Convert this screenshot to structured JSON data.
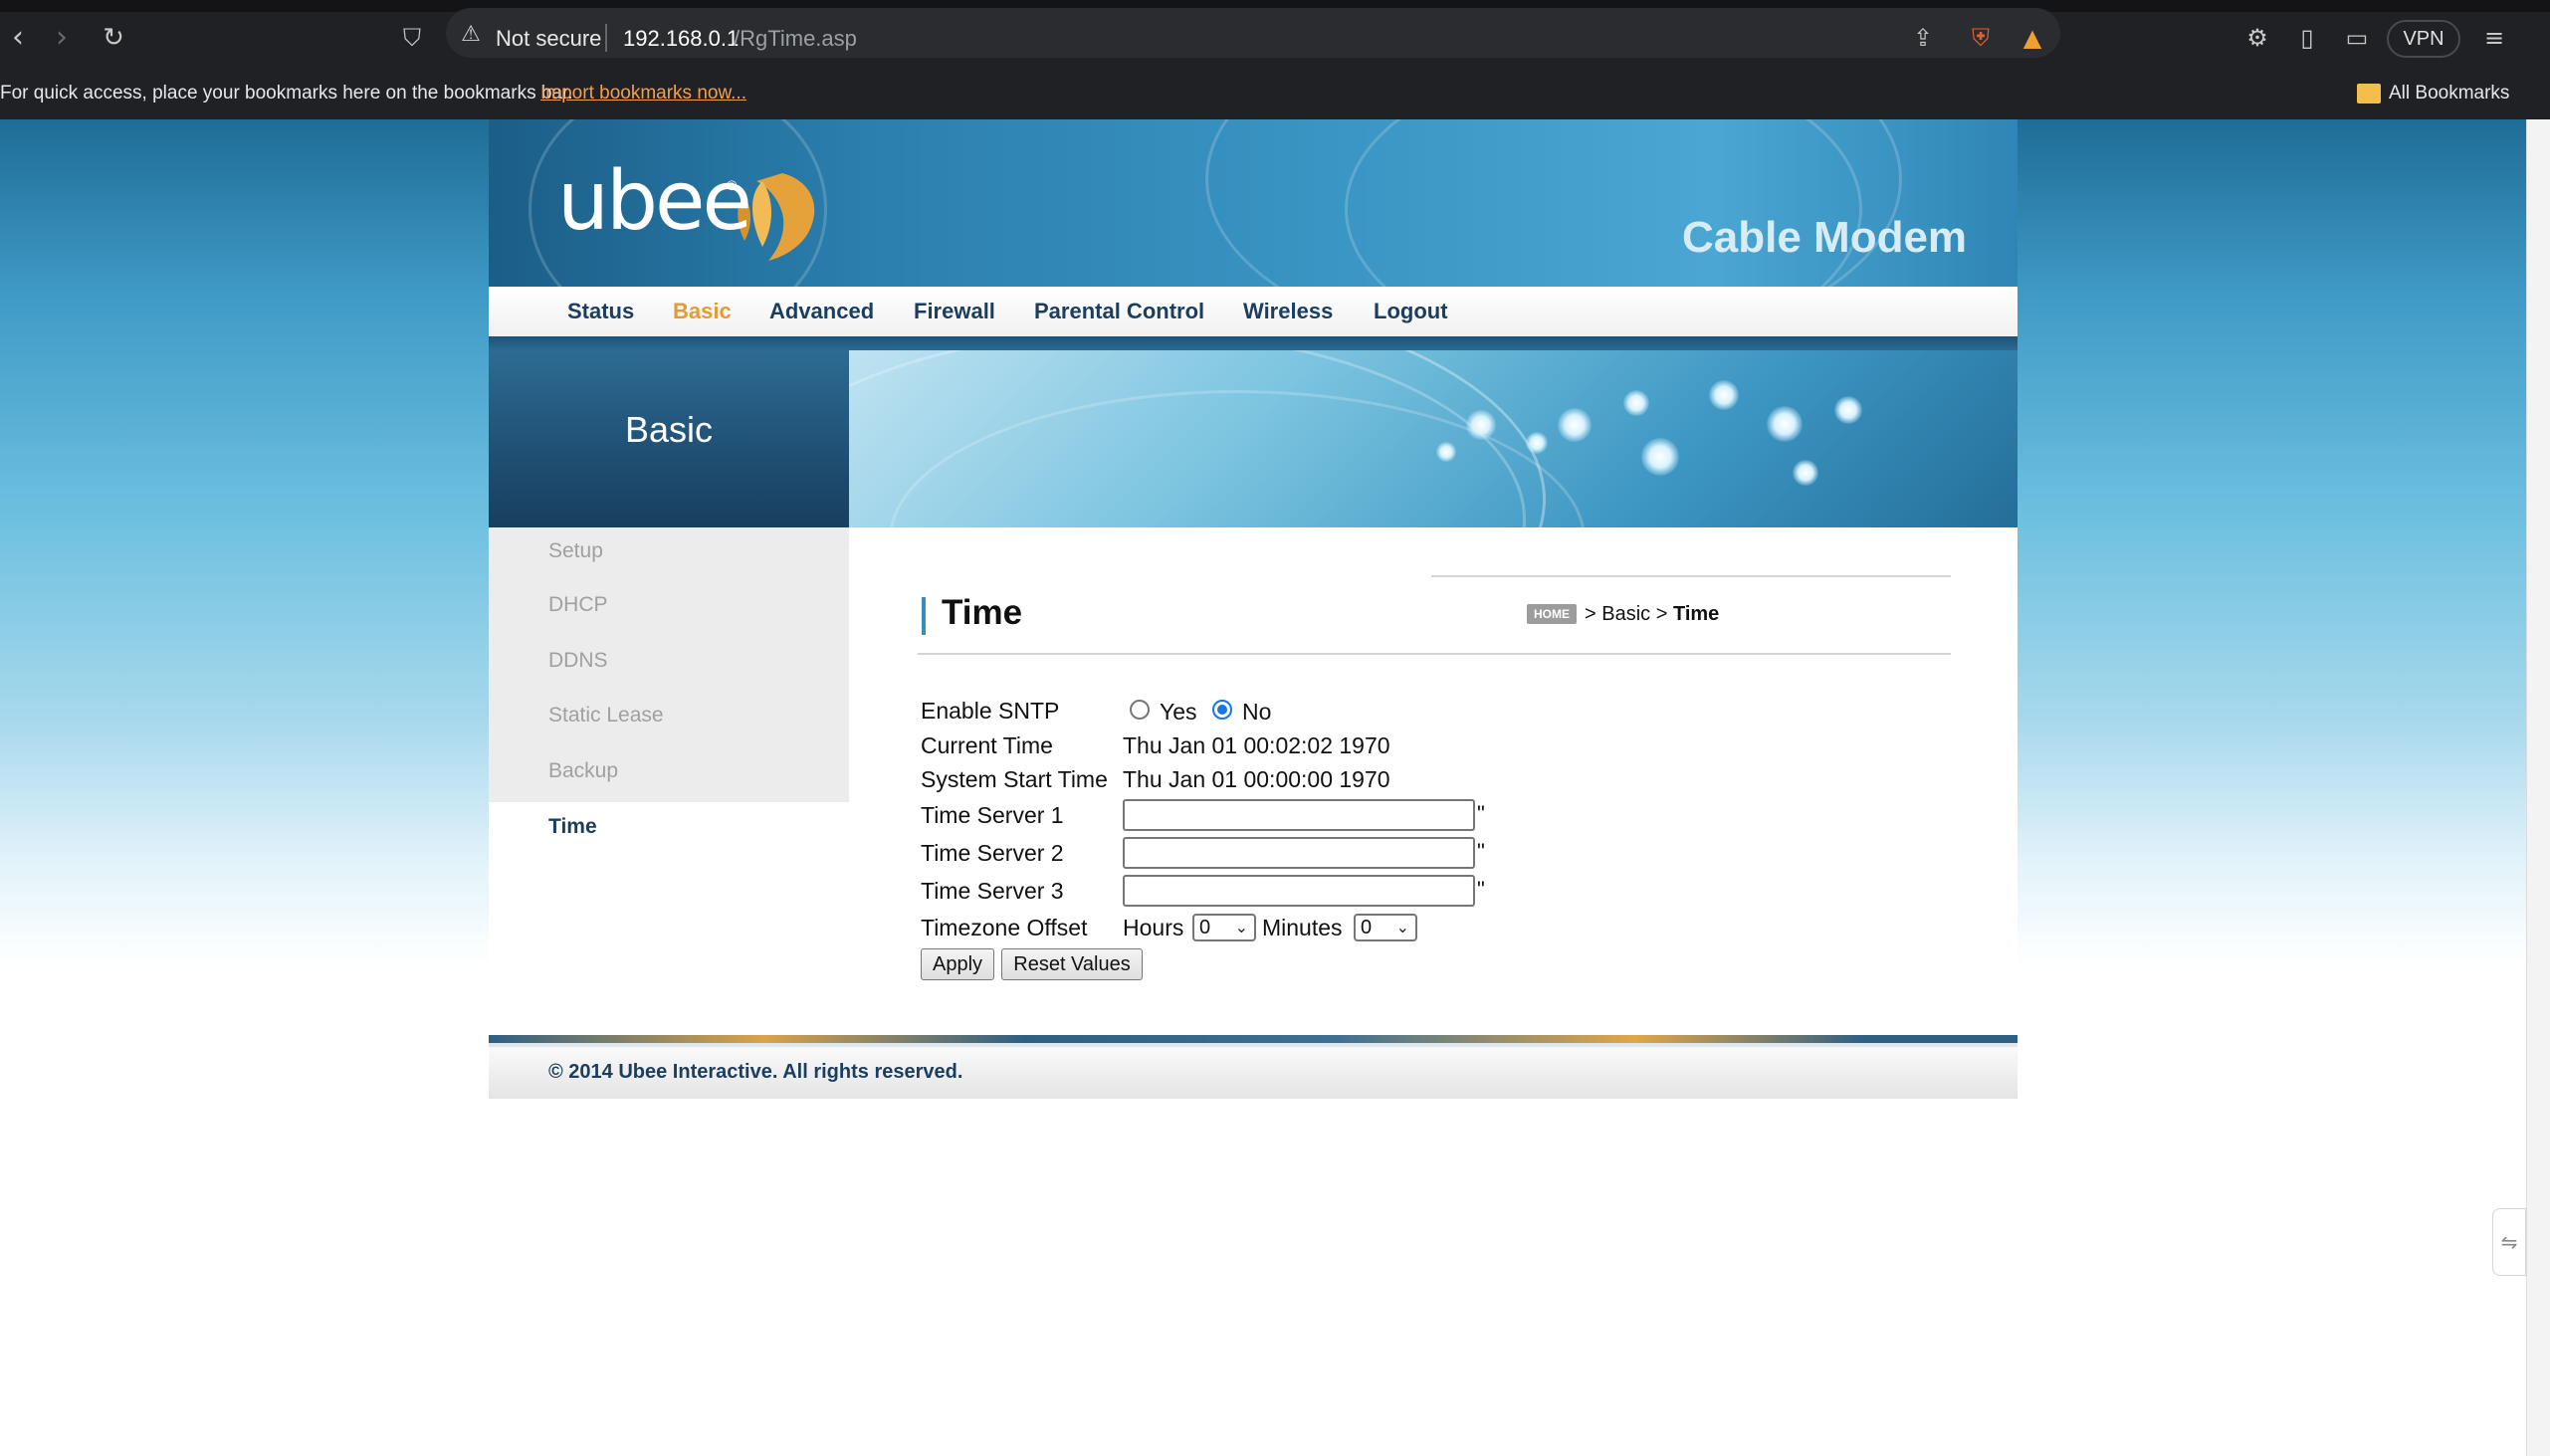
{
  "browser": {
    "security_label": "Not secure",
    "url_host": "192.168.0.1",
    "url_path": "/RgTime.asp",
    "vpn_label": "VPN",
    "bookmarks_message": "For quick access, place your bookmarks here on the bookmarks bar.",
    "bookmarks_import_link": "Import bookmarks now...",
    "all_bookmarks_label": "All Bookmarks"
  },
  "header": {
    "logo_text": "ubee",
    "logo_reg": "®",
    "product_title": "Cable Modem"
  },
  "nav": {
    "items": [
      {
        "label": "Status",
        "active": false
      },
      {
        "label": "Basic",
        "active": true
      },
      {
        "label": "Advanced",
        "active": false
      },
      {
        "label": "Firewall",
        "active": false
      },
      {
        "label": "Parental Control",
        "active": false
      },
      {
        "label": "Wireless",
        "active": false
      },
      {
        "label": "Logout",
        "active": false
      }
    ]
  },
  "section": {
    "title": "Basic"
  },
  "sidebar": {
    "items": [
      {
        "label": "Setup"
      },
      {
        "label": "DHCP"
      },
      {
        "label": "DDNS"
      },
      {
        "label": "Static Lease"
      },
      {
        "label": "Backup"
      },
      {
        "label": "Time"
      }
    ],
    "active_index": 5
  },
  "page": {
    "title": "Time",
    "breadcrumb": {
      "home_badge": "HOME",
      "sep": ">",
      "section": "Basic",
      "current": "Time"
    }
  },
  "form": {
    "enable_sntp_label": "Enable SNTP",
    "radio_yes_label": "Yes",
    "radio_no_label": "No",
    "enable_sntp_value": "No",
    "current_time_label": "Current Time",
    "current_time_value": "Thu Jan 01 00:02:02 1970",
    "system_start_label": "System Start Time",
    "system_start_value": "Thu Jan 01 00:00:00 1970",
    "time_server_1_label": "Time Server 1",
    "time_server_1_value": "",
    "time_server_2_label": "Time Server 2",
    "time_server_2_value": "",
    "time_server_3_label": "Time Server 3",
    "time_server_3_value": "",
    "trailing_mark": "\"",
    "timezone_label": "Timezone Offset",
    "hours_label": "Hours",
    "hours_value": "0",
    "minutes_label": "Minutes",
    "minutes_value": "0",
    "apply_label": "Apply",
    "reset_label": "Reset Values"
  },
  "footer": {
    "copyright": "© 2014 Ubee Interactive. All rights reserved."
  },
  "colors": {
    "nav_text": "#1b3d5e",
    "nav_active": "#e39b37",
    "banner_blue": "#2b7fae"
  }
}
